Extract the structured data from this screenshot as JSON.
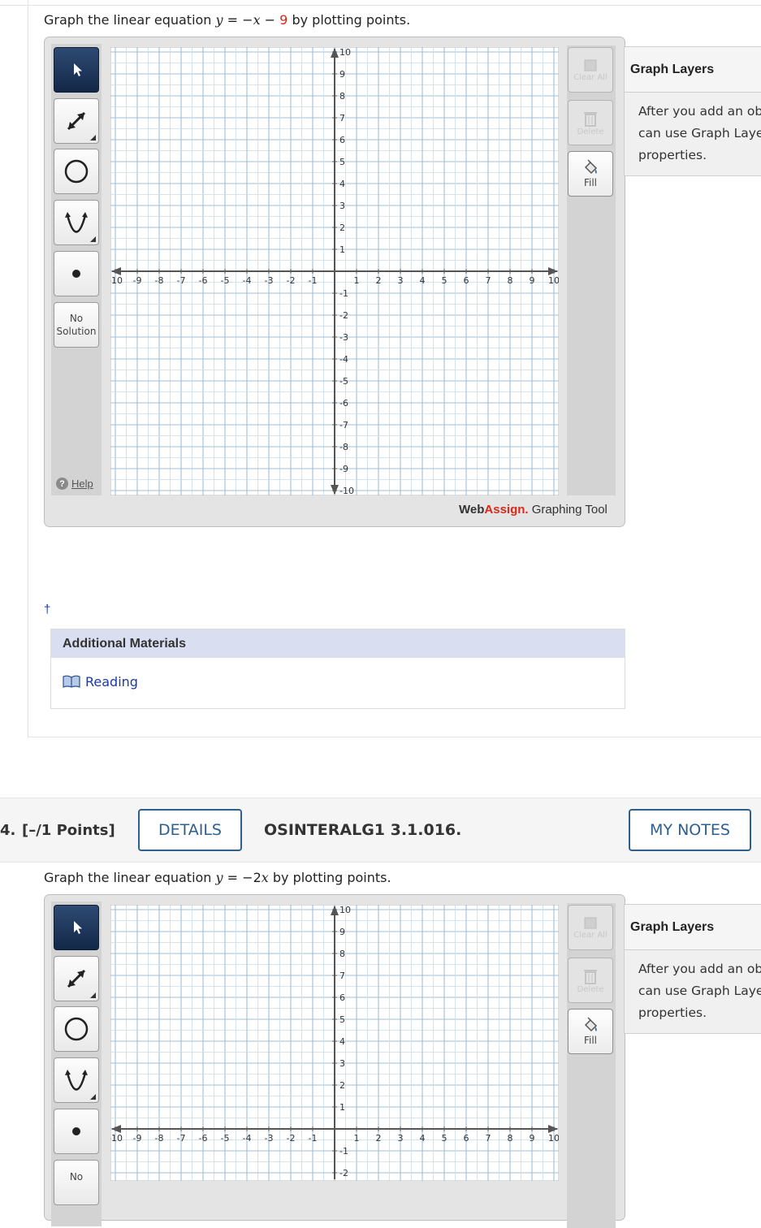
{
  "question3": {
    "prompt": {
      "prefix": "Graph the linear equation ",
      "var_y": "y",
      "eq": " = −",
      "var_x": "x",
      "minus": " − ",
      "constant": "9",
      "suffix": " by plotting points."
    },
    "tools": {
      "select": "select-arrow",
      "line": "line-tool",
      "circle": "circle-tool",
      "parabola": "parabola-tool",
      "point": "point-tool",
      "no_solution_line1": "No",
      "no_solution_line2": "Solution",
      "help": "Help"
    },
    "right_tools": {
      "clear_all": "Clear All",
      "delete": "Delete",
      "fill": "Fill"
    },
    "brand": {
      "web": "Web",
      "assign": "Assign.",
      "tool": " Graphing Tool"
    },
    "graph_layers": {
      "title": "Graph Layers",
      "line1": "After you add an obj",
      "line2": "can use Graph Laye",
      "line3": "properties."
    },
    "dagger": "†",
    "additional_materials": {
      "title": "Additional Materials",
      "reading": "Reading"
    }
  },
  "question4": {
    "number": "4.",
    "points": "[–/1 Points]",
    "details_button": "DETAILS",
    "code": "OSINTERALG1 3.1.016.",
    "notes_button": "MY NOTES",
    "prompt": {
      "prefix": "Graph the linear equation ",
      "var_y": "y",
      "eq": " = −2",
      "var_x": "x",
      "suffix": " by plotting points."
    },
    "tools": {
      "no_solution_line1": "No"
    },
    "right_tools": {
      "clear_all": "Clear All",
      "delete": "Delete",
      "fill": "Fill"
    },
    "graph_layers": {
      "title": "Graph Layers",
      "line1": "After you add an obj",
      "line2": "can use Graph Laye",
      "line3": "properties."
    }
  },
  "graph_axes": {
    "x_ticks": [
      "-10",
      "-9",
      "-8",
      "-7",
      "-6",
      "-5",
      "-4",
      "-3",
      "-2",
      "-1",
      "1",
      "2",
      "3",
      "4",
      "5",
      "6",
      "7",
      "8",
      "9",
      "10"
    ],
    "y_ticks": [
      "10",
      "9",
      "8",
      "7",
      "6",
      "5",
      "4",
      "3",
      "2",
      "1",
      "-1",
      "-2",
      "-3",
      "-4",
      "-5",
      "-6",
      "-7",
      "-8",
      "-9",
      "-10"
    ]
  },
  "colors": {
    "grid_major": "#9fc0d8",
    "grid_minor": "#c9dbe8",
    "axis": "#555555",
    "accent": "#2d5f8f",
    "brand_red": "#d9291c"
  }
}
